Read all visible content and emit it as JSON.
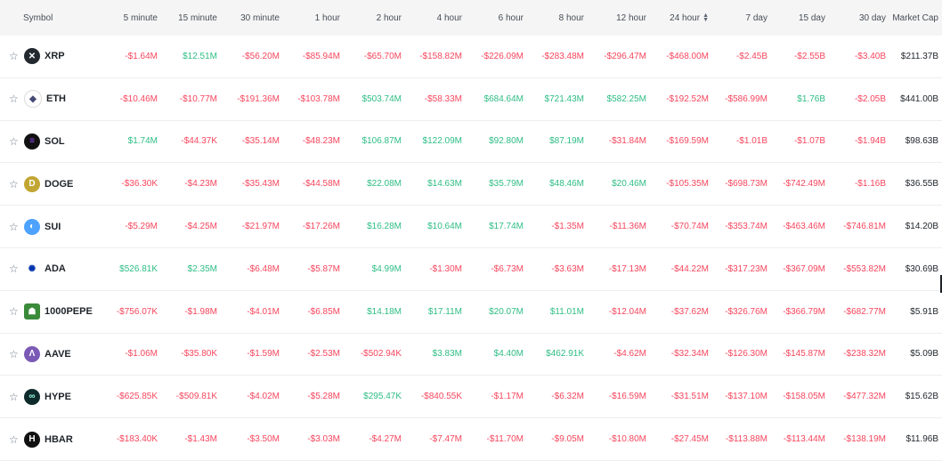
{
  "header": {
    "symbol": "Symbol",
    "cols": [
      "5 minute",
      "15 minute",
      "30 minute",
      "1 hour",
      "2 hour",
      "4 hour",
      "6 hour",
      "8 hour",
      "12 hour",
      "24 hour",
      "7 day",
      "15 day",
      "30 day"
    ],
    "market_cap": "Market Cap"
  },
  "rows": [
    {
      "symbol": "XRP",
      "icon": "xrp-icon",
      "values": [
        "-$1.64M",
        "$12.51M",
        "-$56.20M",
        "-$85.94M",
        "-$65.70M",
        "-$158.82M",
        "-$226.09M",
        "-$283.48M",
        "-$296.47M",
        "-$468.00M",
        "-$2.45B",
        "-$2.55B",
        "-$3.40B"
      ],
      "market_cap": "$211.37B"
    },
    {
      "symbol": "ETH",
      "icon": "eth-icon",
      "values": [
        "-$10.46M",
        "-$10.77M",
        "-$191.36M",
        "-$103.78M",
        "$503.74M",
        "-$58.33M",
        "$684.64M",
        "$721.43M",
        "$582.25M",
        "-$192.52M",
        "-$586.99M",
        "$1.76B",
        "-$2.05B"
      ],
      "market_cap": "$441.00B"
    },
    {
      "symbol": "SOL",
      "icon": "sol-icon",
      "values": [
        "$1.74M",
        "-$44.37K",
        "-$35.14M",
        "-$48.23M",
        "$106.87M",
        "$122.09M",
        "$92.80M",
        "$87.19M",
        "-$31.84M",
        "-$169.59M",
        "-$1.01B",
        "-$1.07B",
        "-$1.94B"
      ],
      "market_cap": "$98.63B"
    },
    {
      "symbol": "DOGE",
      "icon": "doge-icon",
      "values": [
        "-$36.30K",
        "-$4.23M",
        "-$35.43M",
        "-$44.58M",
        "$22.08M",
        "$14.63M",
        "$35.79M",
        "$48.46M",
        "$20.46M",
        "-$105.35M",
        "-$698.73M",
        "-$742.49M",
        "-$1.16B"
      ],
      "market_cap": "$36.55B"
    },
    {
      "symbol": "SUI",
      "icon": "sui-icon",
      "values": [
        "-$5.29M",
        "-$4.25M",
        "-$21.97M",
        "-$17.26M",
        "$16.28M",
        "$10.64M",
        "$17.74M",
        "-$1.35M",
        "-$11.36M",
        "-$70.74M",
        "-$353.74M",
        "-$463.46M",
        "-$746.81M"
      ],
      "market_cap": "$14.20B"
    },
    {
      "symbol": "ADA",
      "icon": "ada-icon",
      "values": [
        "$526.81K",
        "$2.35M",
        "-$6.48M",
        "-$5.87M",
        "$4.99M",
        "-$1.30M",
        "-$6.73M",
        "-$3.63M",
        "-$17.13M",
        "-$44.22M",
        "-$317.23M",
        "-$367.09M",
        "-$553.82M"
      ],
      "market_cap": "$30.69B"
    },
    {
      "symbol": "1000PEPE",
      "icon": "pepe-icon",
      "values": [
        "-$756.07K",
        "-$1.98M",
        "-$4.01M",
        "-$6.85M",
        "$14.18M",
        "$17.11M",
        "$20.07M",
        "$11.01M",
        "-$12.04M",
        "-$37.62M",
        "-$326.76M",
        "-$366.79M",
        "-$682.77M"
      ],
      "market_cap": "$5.91B"
    },
    {
      "symbol": "AAVE",
      "icon": "aave-icon",
      "values": [
        "-$1.06M",
        "-$35.80K",
        "-$1.59M",
        "-$2.53M",
        "-$502.94K",
        "$3.83M",
        "$4.40M",
        "$462.91K",
        "-$4.62M",
        "-$32.34M",
        "-$126.30M",
        "-$145.87M",
        "-$238.32M"
      ],
      "market_cap": "$5.09B"
    },
    {
      "symbol": "HYPE",
      "icon": "hype-icon",
      "values": [
        "-$625.85K",
        "-$509.81K",
        "-$4.02M",
        "-$5.28M",
        "$295.47K",
        "-$840.55K",
        "-$1.17M",
        "-$6.32M",
        "-$16.59M",
        "-$31.51M",
        "-$137.10M",
        "-$158.05M",
        "-$477.32M"
      ],
      "market_cap": "$15.62B"
    },
    {
      "symbol": "HBAR",
      "icon": "hbar-icon",
      "values": [
        "-$183.40K",
        "-$1.43M",
        "-$3.50M",
        "-$3.03M",
        "-$4.27M",
        "-$7.47M",
        "-$11.70M",
        "-$9.05M",
        "-$10.80M",
        "-$27.45M",
        "-$113.88M",
        "-$113.44M",
        "-$138.19M"
      ],
      "market_cap": "$11.96B"
    }
  ],
  "colors": {
    "positive": "#2ebd85",
    "negative": "#f6465d",
    "header_bg": "#f5f5f5"
  }
}
